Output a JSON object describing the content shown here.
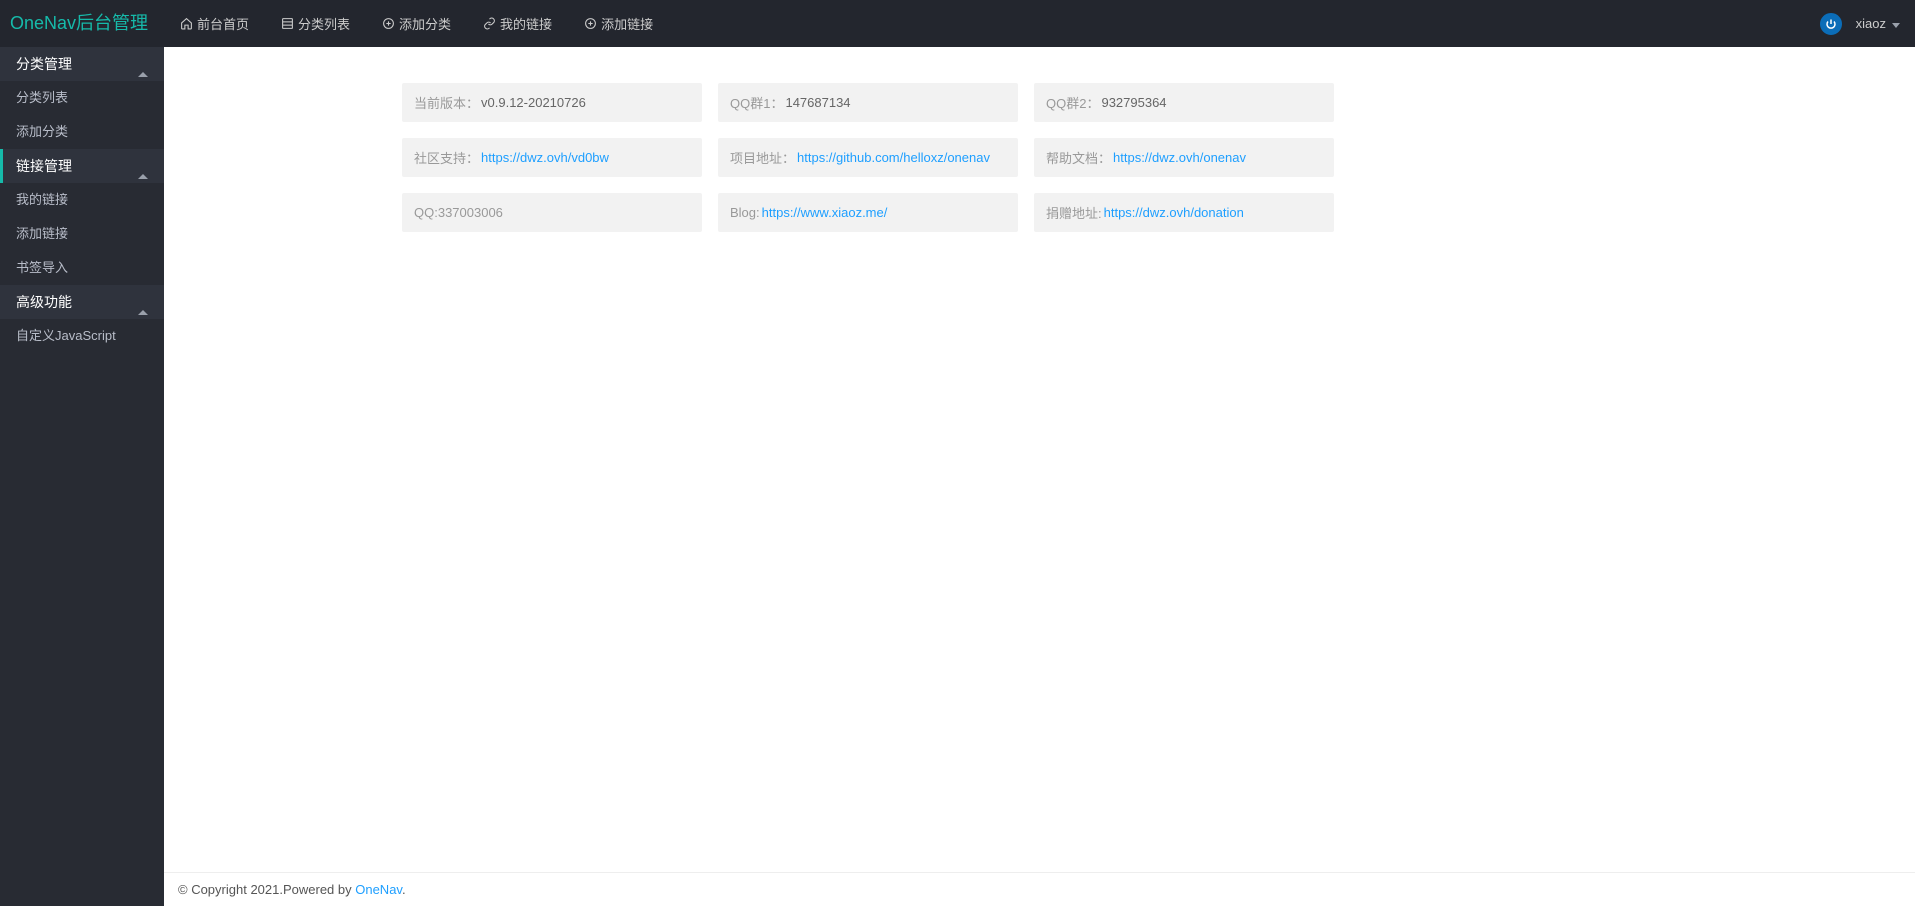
{
  "header": {
    "logo": "OneNav后台管理",
    "nav": [
      {
        "label": "前台首页",
        "icon": "home-icon"
      },
      {
        "label": "分类列表",
        "icon": "list-icon"
      },
      {
        "label": "添加分类",
        "icon": "plus-circle-icon"
      },
      {
        "label": "我的链接",
        "icon": "link-icon"
      },
      {
        "label": "添加链接",
        "icon": "plus-circle-icon"
      }
    ],
    "user": "xiaoz"
  },
  "sidebar": {
    "groups": [
      {
        "title": "分类管理",
        "active": false,
        "items": [
          {
            "label": "分类列表"
          },
          {
            "label": "添加分类"
          }
        ]
      },
      {
        "title": "链接管理",
        "active": true,
        "items": [
          {
            "label": "我的链接"
          },
          {
            "label": "添加链接"
          },
          {
            "label": "书签导入"
          }
        ]
      },
      {
        "title": "高级功能",
        "active": false,
        "items": [
          {
            "label": "自定义JavaScript"
          }
        ]
      }
    ]
  },
  "content": {
    "cards": [
      {
        "label": "当前版本：",
        "value": "v0.9.12-20210726",
        "link": null
      },
      {
        "label": "QQ群1：",
        "value": "147687134",
        "link": null
      },
      {
        "label": "QQ群2：",
        "value": "932795364",
        "link": null
      },
      {
        "label": "社区支持：",
        "value": null,
        "link": "https://dwz.ovh/vd0bw"
      },
      {
        "label": "项目地址：",
        "value": null,
        "link": "https://github.com/helloxz/onenav"
      },
      {
        "label": "帮助文档：",
        "value": null,
        "link": "https://dwz.ovh/onenav"
      },
      {
        "label": "QQ:",
        "value": "337003006",
        "link": null
      },
      {
        "label": "Blog: ",
        "value": null,
        "link": "https://www.xiaoz.me/"
      },
      {
        "label": "捐赠地址: ",
        "value": null,
        "link": "https://dwz.ovh/donation"
      }
    ]
  },
  "footer": {
    "text_prefix": "© Copyright 2021.Powered by ",
    "link_text": "OneNav",
    "text_suffix": "."
  }
}
